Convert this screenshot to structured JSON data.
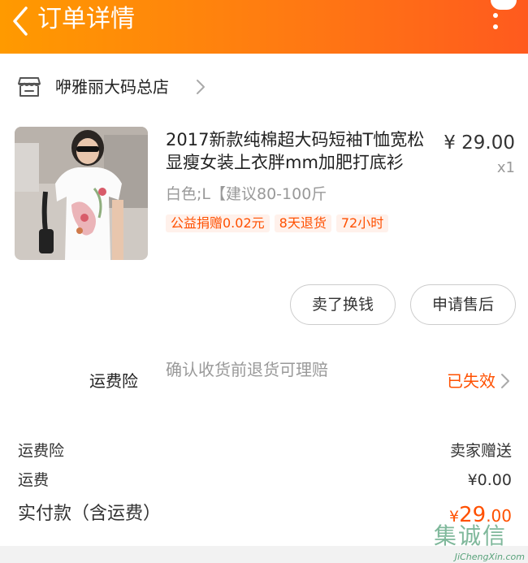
{
  "header": {
    "title": "订单详情"
  },
  "shop": {
    "name": "咿雅丽大码总店"
  },
  "product": {
    "title": "2017新款纯棉超大码短袖T恤宽松显瘦女装上衣胖mm加肥打底衫",
    "price": "¥ 29.00",
    "quantity": "x1",
    "sku": "白色;L【建议80-100斤",
    "tags": [
      "公益捐赠0.02元",
      "8天退货",
      "72小时"
    ]
  },
  "actions": {
    "sell_label": "卖了换钱",
    "after_sale_label": "申请售后"
  },
  "insurance": {
    "label": "运费险",
    "description": "确认收货前退货可理赔",
    "status": "已失效"
  },
  "summary": {
    "rows": [
      {
        "label": "运费险",
        "value": "卖家赠送"
      },
      {
        "label": "运费",
        "value": "¥0.00"
      }
    ],
    "total_label": "实付款（含运费）",
    "total_currency": "¥",
    "total_integer": "29",
    "total_decimal": ".00"
  },
  "watermark": {
    "glyphs": "集诚信",
    "domain": "JiChengXin.com"
  },
  "colors": {
    "header_start": "#ff9a00",
    "header_end": "#ff5a1e",
    "accent": "#ff5000"
  },
  "icons": {
    "back": "chevron-left-icon",
    "more": "vertical-ellipsis-icon",
    "shop": "store-icon",
    "chevron": "chevron-right-icon"
  }
}
